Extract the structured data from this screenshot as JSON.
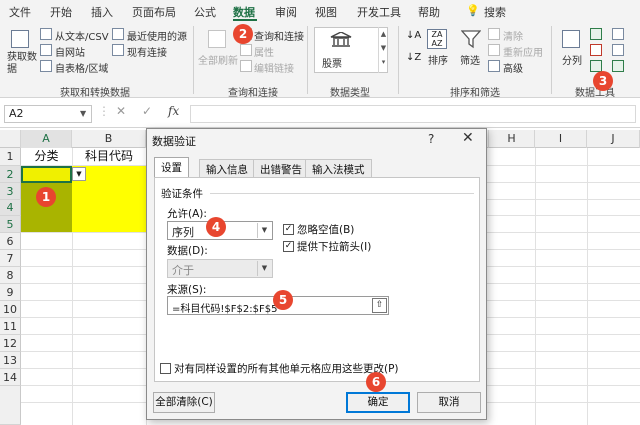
{
  "ribbon": {
    "tabs": [
      "文件",
      "开始",
      "插入",
      "页面布局",
      "公式",
      "数据",
      "审阅",
      "视图",
      "开发工具",
      "帮助"
    ],
    "active_tab": "数据",
    "search_label": "搜索",
    "groups": {
      "get": {
        "label": "获取和转换数据",
        "big_button": "获取数据",
        "items": [
          "从文本/CSV",
          "自网站",
          "自表格/区域",
          "最近使用的源",
          "现有连接"
        ]
      },
      "query": {
        "label": "查询和连接",
        "refresh": "全部刷新",
        "items": [
          "查询和连接",
          "属性",
          "编辑链接"
        ]
      },
      "types": {
        "label": "数据类型",
        "stock": "股票"
      },
      "sort": {
        "label": "排序和筛选",
        "sort": "排序",
        "filter": "筛选",
        "clear": "清除",
        "reapply": "重新应用",
        "advanced": "高级"
      },
      "tools": {
        "label": "数据工具",
        "split": "分列"
      }
    }
  },
  "formula_bar": {
    "name_box": "A2",
    "fx": "fx",
    "cancel": "✕",
    "confirm": "✓",
    "more": "⋮"
  },
  "sheet": {
    "columns": [
      "A",
      "B",
      "C",
      "D",
      "E",
      "F",
      "G",
      "H",
      "I",
      "J",
      "K"
    ],
    "rows": [
      "1",
      "2",
      "3",
      "4",
      "5",
      "6",
      "7",
      "8",
      "9",
      "10",
      "11",
      "12",
      "13",
      "14"
    ],
    "cells": {
      "A1": "分类",
      "B1": "科目代码"
    }
  },
  "dialog": {
    "title": "数据验证",
    "help": "?",
    "close": "✕",
    "tabs": [
      "设置",
      "输入信息",
      "出错警告",
      "输入法模式"
    ],
    "section": "验证条件",
    "allow_label": "允许(A):",
    "allow_value": "序列",
    "data_label": "数据(D):",
    "data_value": "介于",
    "ignore_blank": "忽略空值(B)",
    "dropdown": "提供下拉箭头(I)",
    "source_label": "来源(S):",
    "source_value": "=科目代码!$F$2:$F$5",
    "apply_all": "对有同样设置的所有其他单元格应用这些更改(P)",
    "clear_all": "全部清除(C)",
    "ok": "确定",
    "cancel": "取消"
  },
  "callouts": [
    "1",
    "2",
    "3",
    "4",
    "5",
    "6"
  ],
  "colors": {
    "accent": "#1e7145",
    "callout": "#e8462f",
    "cell_fill": "#ffff00",
    "selection_fill": "#a9b400"
  }
}
